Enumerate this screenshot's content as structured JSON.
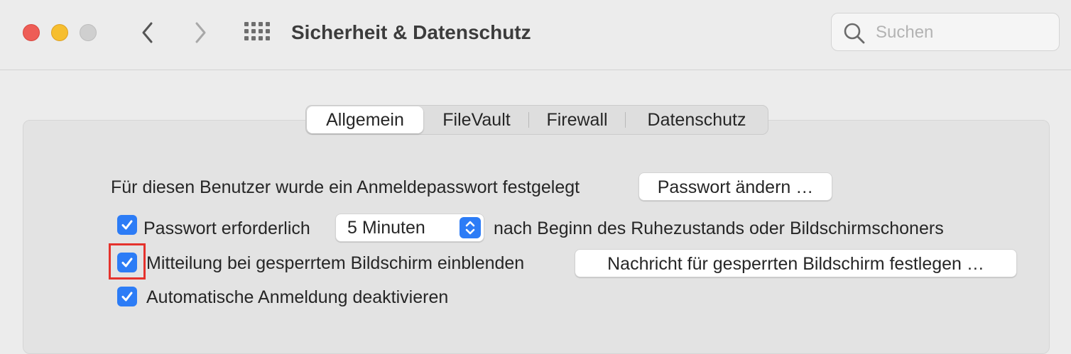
{
  "window": {
    "title": "Sicherheit & Datenschutz",
    "search_placeholder": "Suchen"
  },
  "tabs": [
    {
      "label": "Allgemein",
      "selected": true
    },
    {
      "label": "FileVault",
      "selected": false
    },
    {
      "label": "Firewall",
      "selected": false
    },
    {
      "label": "Datenschutz",
      "selected": false
    }
  ],
  "general": {
    "password_set_text": "Für diesen Benutzer wurde ein Anmeldepasswort festgelegt",
    "change_password_button": "Passwort ändern …",
    "require_password": {
      "checked": true,
      "label": "Passwort erforderlich",
      "delay_value": "5 Minuten",
      "suffix": "nach Beginn des Ruhezustands oder Bildschirmschoners"
    },
    "lock_message": {
      "checked": true,
      "label": "Mitteilung bei gesperrtem Bildschirm einblenden",
      "button": "Nachricht für gesperrten Bildschirm festlegen …"
    },
    "disable_autologin": {
      "checked": true,
      "label": "Automatische Anmeldung deaktivieren"
    }
  },
  "colors": {
    "accent": "#2c7cf6",
    "highlight": "#e5322c"
  },
  "icons": [
    "close-icon",
    "minimize-icon",
    "zoom-icon",
    "chevron-left-icon",
    "chevron-right-icon",
    "grid-icon",
    "search-icon",
    "checkmark-icon",
    "up-down-chevron-icon"
  ]
}
